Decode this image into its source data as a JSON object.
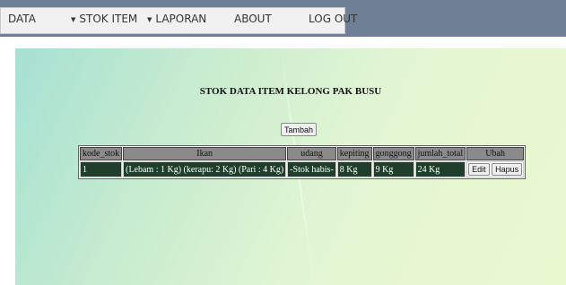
{
  "nav": {
    "items": [
      {
        "label": "DATA"
      },
      {
        "label": "STOK ITEM"
      },
      {
        "label": "LAPORAN"
      },
      {
        "label": "ABOUT"
      },
      {
        "label": "LOG OUT"
      }
    ],
    "caret": "▼"
  },
  "page": {
    "title": "STOK DATA ITEM KELONG PAK BUSU",
    "add_button": "Tambah"
  },
  "table": {
    "headers": [
      "kode_stok",
      "Ikan",
      "udang",
      "kepiting",
      "gonggong",
      "jumlah_total",
      "Ubah"
    ],
    "rows": [
      {
        "kode_stok": "1",
        "ikan": "(Lebam : 1 Kg) (kerapu: 2 Kg) (Pari : 4 Kg)",
        "udang": "-Stok habis-",
        "kepiting": "8 Kg",
        "gonggong": "9 Kg",
        "jumlah_total": "24 Kg",
        "edit_label": "Edit",
        "delete_label": "Hapus"
      }
    ]
  },
  "colors": {
    "topbar": "#6f8096",
    "table_row": "#1f3f2c",
    "table_header": "#8a8a8a"
  }
}
